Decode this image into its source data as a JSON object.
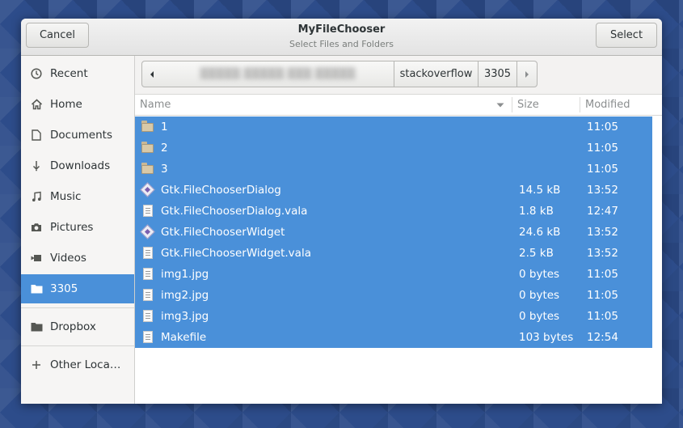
{
  "window": {
    "title": "MyFileChooser",
    "subtitle": "Select Files and Folders",
    "cancel_label": "Cancel",
    "select_label": "Select"
  },
  "sidebar": {
    "items": [
      {
        "label": "Recent",
        "icon": "clock-icon"
      },
      {
        "label": "Home",
        "icon": "home-icon"
      },
      {
        "label": "Documents",
        "icon": "document-icon"
      },
      {
        "label": "Downloads",
        "icon": "download-icon"
      },
      {
        "label": "Music",
        "icon": "music-icon"
      },
      {
        "label": "Pictures",
        "icon": "camera-icon"
      },
      {
        "label": "Videos",
        "icon": "video-icon"
      },
      {
        "label": "3305",
        "icon": "folder-icon",
        "selected": true
      },
      {
        "label": "Dropbox",
        "icon": "folder-icon"
      },
      {
        "label": "Other Loca…",
        "icon": "plus-icon"
      }
    ]
  },
  "pathbar": {
    "blurred_label": "▒▒▒▒▒ ▒▒▒▒▒ ▒▒▒ ▒▒▒▒▒",
    "segments": [
      "stackoverflow",
      "3305"
    ]
  },
  "columns": {
    "name": "Name",
    "size": "Size",
    "modified": "Modified"
  },
  "files": [
    {
      "name": "1",
      "size": "",
      "modified": "11:05",
      "type": "folder"
    },
    {
      "name": "2",
      "size": "",
      "modified": "11:05",
      "type": "folder"
    },
    {
      "name": "3",
      "size": "",
      "modified": "11:05",
      "type": "folder"
    },
    {
      "name": "Gtk.FileChooserDialog",
      "size": "14.5 kB",
      "modified": "13:52",
      "type": "executable"
    },
    {
      "name": "Gtk.FileChooserDialog.vala",
      "size": "1.8 kB",
      "modified": "12:47",
      "type": "text"
    },
    {
      "name": "Gtk.FileChooserWidget",
      "size": "24.6 kB",
      "modified": "13:52",
      "type": "executable"
    },
    {
      "name": "Gtk.FileChooserWidget.vala",
      "size": "2.5 kB",
      "modified": "13:52",
      "type": "text"
    },
    {
      "name": "img1.jpg",
      "size": "0 bytes",
      "modified": "11:05",
      "type": "text"
    },
    {
      "name": "img2.jpg",
      "size": "0 bytes",
      "modified": "11:05",
      "type": "text"
    },
    {
      "name": "img3.jpg",
      "size": "0 bytes",
      "modified": "11:05",
      "type": "text"
    },
    {
      "name": "Makefile",
      "size": "103 bytes",
      "modified": "12:54",
      "type": "text"
    }
  ],
  "colors": {
    "selection": "#4a90d9",
    "desktop": "#2f4f8e"
  }
}
